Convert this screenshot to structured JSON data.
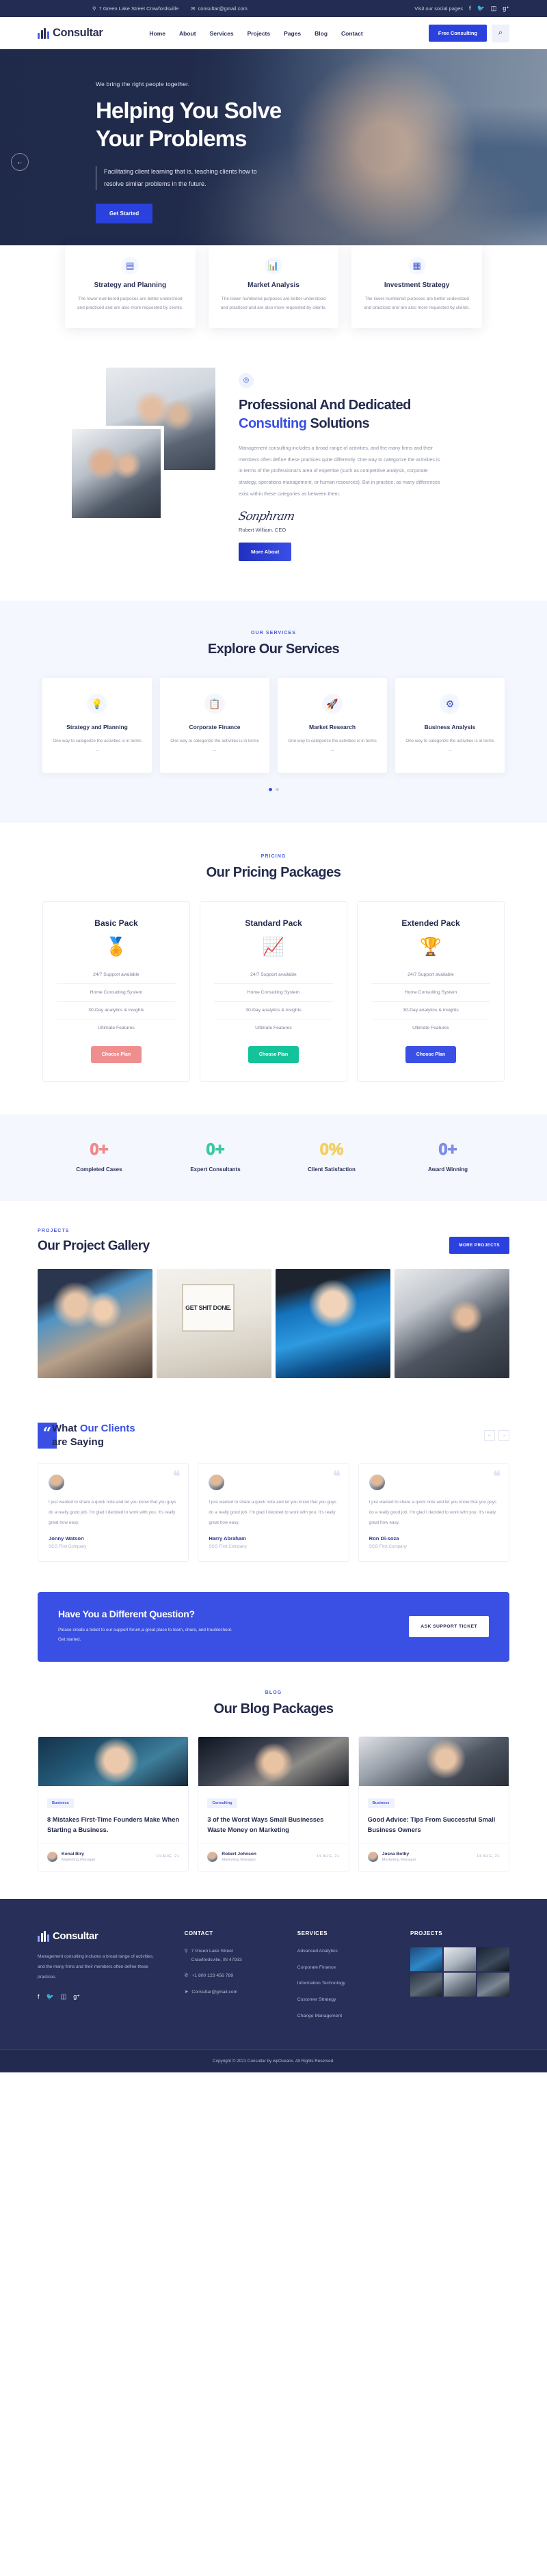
{
  "topbar": {
    "address": "7 Green Lake Street Crawfordsville",
    "email": "consultar@gmail.com",
    "social_label": "Visit our social pages",
    "socials": [
      "facebook-icon",
      "twitter-icon",
      "instagram-icon",
      "google-plus-icon"
    ]
  },
  "nav": {
    "brand": "Consultar",
    "links": [
      "Home",
      "About",
      "Services",
      "Projects",
      "Pages",
      "Blog",
      "Contact"
    ],
    "cta": "Free Consulting",
    "search_icon": "search-icon"
  },
  "hero": {
    "kicker": "We bring the right people together.",
    "title_line1": "Helping You Solve",
    "title_line2": "Your Problems",
    "subtitle": "Facilitating client learning that is, teaching clients how to resolve similar problems in the future.",
    "button": "Get Started",
    "prev_arrow": "←"
  },
  "features": [
    {
      "title": "Strategy and Planning",
      "desc": "The lower-numbered purposes are better understood and practiced and are also more requested by clients.",
      "icon": "document-check-icon"
    },
    {
      "title": "Market Analysis",
      "desc": "The lower-numbered purposes are better understood and practiced and are also more requested by clients.",
      "icon": "bar-chart-icon"
    },
    {
      "title": "Investment Strategy",
      "desc": "The lower-numbered purposes are better understood and practiced and are also more requested by clients.",
      "icon": "clipboard-icon"
    }
  ],
  "about": {
    "icon": "badge-icon",
    "heading_line1": "Professional And Dedicated",
    "heading_accent": "Consulting",
    "heading_rest": " Solutions",
    "paragraph": "Management consulting includes a broad range of activities, and the many firms and their members often define these practices quite differently. One way to categorize the activities is in terms of the professional's area of expertise (such as competitive analysis, corporate strategy, operations management, or human resources). But in practice, as many differences exist within these categories as between them.",
    "signature": "Sonphram",
    "signer": "Robert William, CEO",
    "button": "More About"
  },
  "services": {
    "kicker": "OUR SERVICES",
    "heading": "Explore Our Services",
    "items": [
      {
        "title": "Strategy and Planning",
        "desc": "One way to categorize the activities is in terms ...",
        "icon": "lightbulb-icon"
      },
      {
        "title": "Corporate Finance",
        "desc": "One way to categorize the activities is in terms ...",
        "icon": "clipboard-pen-icon"
      },
      {
        "title": "Market Research",
        "desc": "One way to categorize the activities is in terms ...",
        "icon": "rocket-icon"
      },
      {
        "title": "Business Analysis",
        "desc": "One way to categorize the activities is in terms ...",
        "icon": "gear-icon"
      }
    ],
    "dots": 2,
    "active_dot": 0
  },
  "pricing": {
    "kicker": "PRICING",
    "heading": "Our Pricing Packages",
    "plans": [
      {
        "name": "Basic Pack",
        "icon": "award-ribbon-icon",
        "features": [
          "24/7 Support available",
          "Home Consulting System",
          "30-Day analytics & insights",
          "Ultimate Features"
        ],
        "button": "Choose Plan",
        "color": "#ef8e8e"
      },
      {
        "name": "Standard Pack",
        "icon": "chart-bars-icon",
        "features": [
          "24/7 Support available",
          "Home Consulting System",
          "30-Day analytics & insights",
          "Ultimate Features"
        ],
        "button": "Choose Plan",
        "color": "#15c39a"
      },
      {
        "name": "Extended Pack",
        "icon": "trophy-icon",
        "features": [
          "24/7 Support available",
          "Home Consulting System",
          "30-Day analytics & insights",
          "Ultimate Features"
        ],
        "button": "Choose Plan",
        "color": "#3a50e4"
      }
    ]
  },
  "counters": [
    {
      "value": "0+",
      "label": "Completed Cases",
      "color": "#f08a8a"
    },
    {
      "value": "0+",
      "label": "Expert Consultants",
      "color": "#3fc8a2"
    },
    {
      "value": "0%",
      "label": "Client Satisfaction",
      "color": "#f4cf63"
    },
    {
      "value": "0+",
      "label": "Award Winning",
      "color": "#7d8de8"
    }
  ],
  "projects": {
    "kicker": "PROJECTS",
    "heading": "Our Project Gallery",
    "button": "MORE PROJECTS",
    "images": [
      "handshake-meeting-photo",
      "get-shit-done-desk-photo",
      "skyscraper-handshake-photo",
      "headset-support-agent-photo"
    ],
    "poster_text": "GET SHIT DONE."
  },
  "testimonials": {
    "quote_mark": "“",
    "heading_accent1": "What ",
    "heading_accent2": "Our Clients",
    "heading_line2": "are Saying",
    "prev": "←",
    "next": "→",
    "items": [
      {
        "quote": "I just wanted to share a quick note and let you know that you guys do a really good job. I'm glad I decided to work with you. It's really great how easy.",
        "name": "Jonny Watson",
        "company": "SCG First Company"
      },
      {
        "quote": "I just wanted to share a quick note and let you know that you guys do a really good job. I'm glad I decided to work with you. It's really great how easy.",
        "name": "Harry Abraham",
        "company": "SCG First Company"
      },
      {
        "quote": "I just wanted to share a quick note and let you know that you guys do a really good job. I'm glad I decided to work with you. It's really great how easy.",
        "name": "Ron Di-soza",
        "company": "SCG First Company"
      }
    ]
  },
  "cta": {
    "heading": "Have You a Different Question?",
    "paragraph": "Please create a ticket to our support forum,a great place to learn, share, and troubleshoot. Get started.",
    "button": "ASK SUPPORT TICKET"
  },
  "blog": {
    "kicker": "BLOG",
    "heading": "Our Blog Packages",
    "posts": [
      {
        "tag": "Business",
        "title": "8 Mistakes First-Time Founders Make When Starting a Business.",
        "author": "Konal Biry",
        "role": "Marketing Manager",
        "date": "14 AUG, 21"
      },
      {
        "tag": "Consulting",
        "title": "3 of the Worst Ways Small Businesses Waste Money on Marketing",
        "author": "Robert Johnson",
        "role": "Marketing Manager",
        "date": "14 AUG, 21"
      },
      {
        "tag": "Business",
        "title": "Good Advice: Tips From Successful Small Business Owners",
        "author": "Josna Bothy",
        "role": "Marketing Manager",
        "date": "14 AUG, 21"
      }
    ]
  },
  "footer": {
    "brand": "Consultar",
    "about": "Management consulting includes a broad range of activities, and the many firms and their members often define these practices.",
    "socials": [
      "facebook-icon",
      "twitter-icon",
      "instagram-icon",
      "google-plus-icon"
    ],
    "contact_heading": "CONTACT",
    "contact": [
      {
        "icon": "location-pin-icon",
        "line1": "7 Green Lake Street",
        "line2": "Crawfordsville, IN 47933"
      },
      {
        "icon": "phone-icon",
        "line1": "+1 800 123 456 789",
        "line2": ""
      },
      {
        "icon": "paper-plane-icon",
        "line1": "Consultar@gmail.com",
        "line2": ""
      }
    ],
    "services_heading": "SERVICES",
    "services": [
      "Advanced Analytics",
      "Corporate Finance",
      "Information Technology",
      "Customer Strategy",
      "Change Management"
    ],
    "projects_heading": "PROJECTS",
    "copyright": "Copyright © 2021 Consultar by wpOceans. All Rights Reserved."
  }
}
